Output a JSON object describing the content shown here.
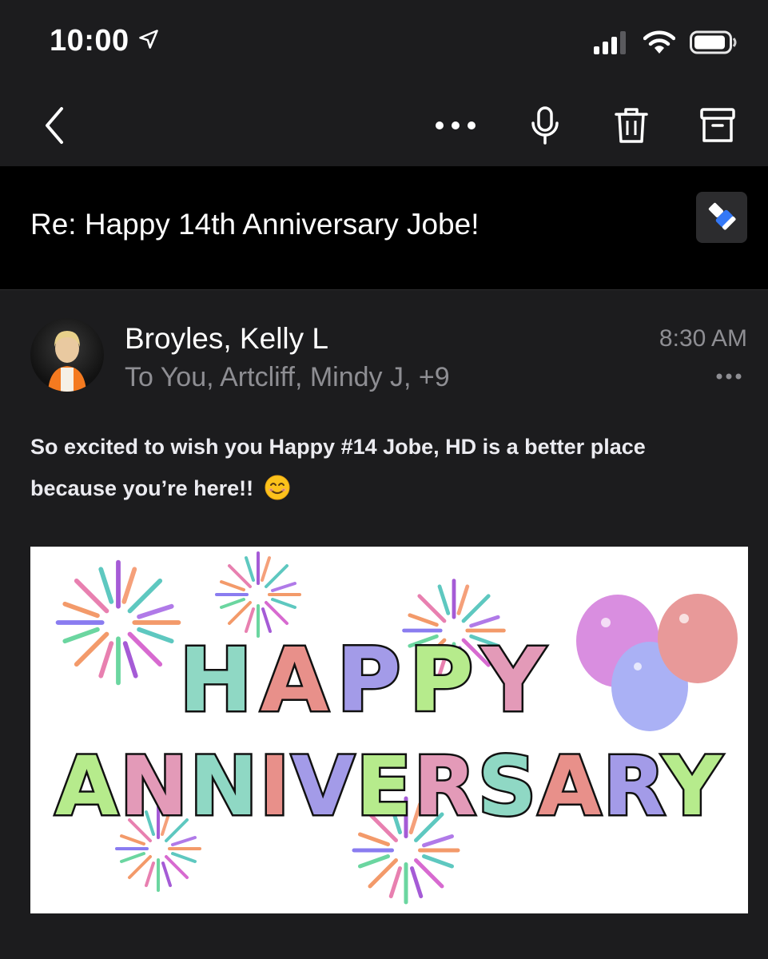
{
  "status_bar": {
    "time": "10:00",
    "icons": [
      "location-arrow-icon",
      "cellular-signal-icon",
      "wifi-icon",
      "battery-icon"
    ]
  },
  "toolbar": {
    "icons": [
      "back-chevron-icon",
      "more-icon",
      "microphone-icon",
      "trash-icon",
      "archive-icon"
    ]
  },
  "email": {
    "subject": "Re: Happy 14th Anniversary Jobe!",
    "sender": "Broyles, Kelly L",
    "recipients": "To You, Artcliff, Mindy J, +9",
    "time": "8:30 AM",
    "body_line1": "So excited to wish you Happy #14 Jobe, HD is a better place",
    "body_line2": "because you’re here!!",
    "emoji": "smiling-face-icon"
  },
  "card": {
    "line1": "HAPPY",
    "line2": "ANNIVERSARY",
    "colors": [
      "#8fd8c4",
      "#e8908a",
      "#a39be8",
      "#b6eb8c",
      "#e39ab8"
    ]
  },
  "colors": {
    "background": "#1c1c1e",
    "subject_background": "#000000",
    "secondary_text": "#8e8e93",
    "accent": "#3478f6"
  }
}
